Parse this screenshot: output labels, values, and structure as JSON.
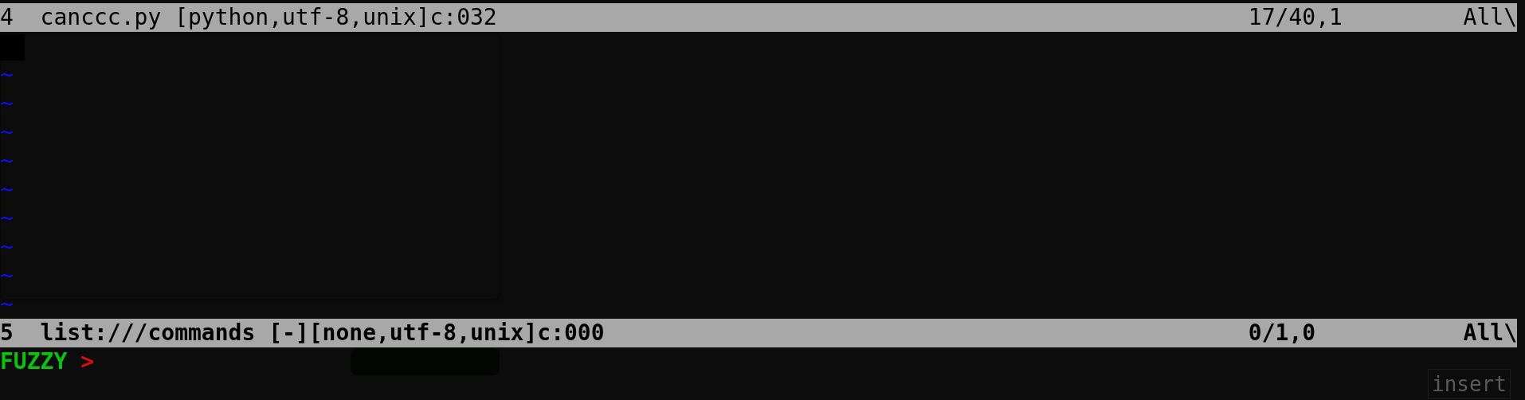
{
  "windows": [
    {
      "number": "4",
      "status": "canccc.py [python,utf-8,unix]c:032",
      "position": "17/40,1",
      "scroll": "All\\",
      "current": false,
      "lines": [
        {
          "kind": "cursor"
        },
        {
          "kind": "tilde",
          "text": "~"
        },
        {
          "kind": "tilde",
          "text": "~"
        },
        {
          "kind": "tilde",
          "text": "~"
        },
        {
          "kind": "tilde",
          "text": "~"
        },
        {
          "kind": "tilde",
          "text": "~"
        },
        {
          "kind": "tilde",
          "text": "~"
        },
        {
          "kind": "tilde",
          "text": "~"
        },
        {
          "kind": "tilde",
          "text": "~"
        },
        {
          "kind": "tilde",
          "text": "~"
        }
      ]
    },
    {
      "number": "5",
      "status": "list:///commands [-][none,utf-8,unix]c:000",
      "position": "0/1,0",
      "scroll": "All\\",
      "current": true
    }
  ],
  "prompt": {
    "mode": "FUZZY",
    "symbol": ">"
  },
  "overlay": {
    "label": "insert"
  }
}
